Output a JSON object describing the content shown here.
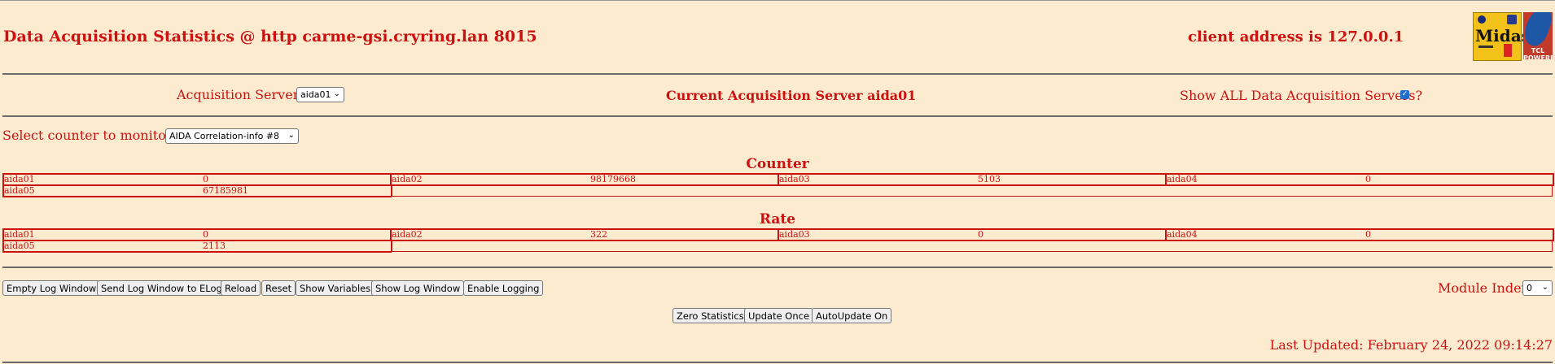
{
  "header": {
    "title": "Data Acquisition Statistics @ http carme-gsi.cryring.lan 8015",
    "client_address": "client address is 127.0.0.1",
    "midas_logo_text": "Midas",
    "tcl_logo_text": "TCL POWERED"
  },
  "servers": {
    "label": "Acquisition Servers",
    "selected": "aida01",
    "current_label": "Current Acquisition Server aida01",
    "show_all_label": "Show ALL Data Acquisition Servers?",
    "show_all_checked": true
  },
  "counter_select": {
    "label": "Select counter to monitor",
    "selected": "AIDA Correlation-info #8"
  },
  "counter": {
    "title": "Counter",
    "cells": [
      {
        "name": "aida01",
        "value": "0"
      },
      {
        "name": "aida02",
        "value": "98179668"
      },
      {
        "name": "aida03",
        "value": "5103"
      },
      {
        "name": "aida04",
        "value": "0"
      },
      {
        "name": "aida05",
        "value": "67185981"
      }
    ]
  },
  "rate": {
    "title": "Rate",
    "cells": [
      {
        "name": "aida01",
        "value": "0"
      },
      {
        "name": "aida02",
        "value": "322"
      },
      {
        "name": "aida03",
        "value": "0"
      },
      {
        "name": "aida04",
        "value": "0"
      },
      {
        "name": "aida05",
        "value": "2113"
      }
    ]
  },
  "buttons_row1": [
    "Empty Log Window",
    "Send Log Window to ELog",
    "Reload",
    "Reset",
    "Show Variables",
    "Show Log Window",
    "Enable Logging"
  ],
  "module_index": {
    "label": "Module Index",
    "selected": "0"
  },
  "buttons_row2": [
    "Zero Statistics",
    "Update Once",
    "AutoUpdate On"
  ],
  "status": {
    "last_updated": "Last Updated: February 24, 2022 09:14:27"
  },
  "colors": {
    "background": "#fdebd0",
    "text": "#cc1111",
    "rule": "#6b6b6b"
  }
}
